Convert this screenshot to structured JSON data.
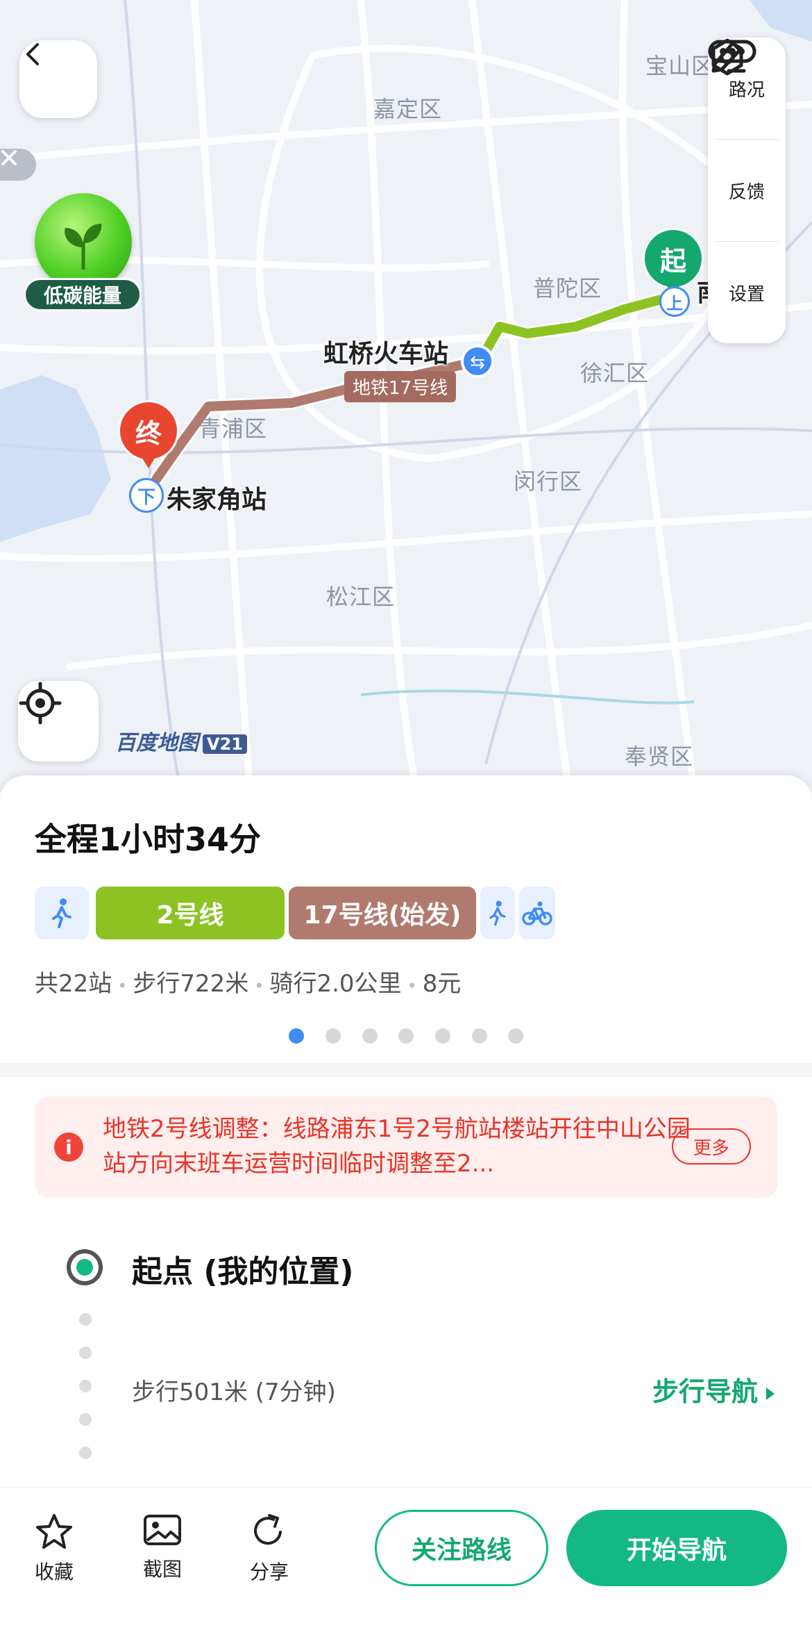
{
  "map": {
    "districts": [
      "宝山区",
      "嘉定区",
      "普陀区",
      "徐汇区",
      "青浦区",
      "闵行区",
      "松江区",
      "奉贤区"
    ],
    "stations": {
      "hongqiao": "虹桥火车站",
      "zhujiajiao": "朱家角站",
      "start_partial": "南"
    },
    "line_tag": "地铁17号线",
    "start_marker": "起",
    "end_marker": "终",
    "board_marker": "上",
    "alight_marker": "下",
    "eco_label": "低碳能量",
    "brand": "百度地图",
    "brand_version": "V21",
    "side_panel": {
      "traffic": "路况",
      "feedback": "反馈",
      "settings": "设置"
    }
  },
  "route": {
    "total_time": "全程1小时34分",
    "segments": [
      {
        "type": "walk",
        "icon": "walk-icon"
      },
      {
        "type": "line",
        "label": "2号线",
        "color": "#8cc322"
      },
      {
        "type": "line",
        "label": "17号线(始发)",
        "color": "#b17a6f"
      },
      {
        "type": "walk",
        "icon": "walk-icon"
      },
      {
        "type": "bike",
        "icon": "bike-icon"
      }
    ],
    "summary": {
      "stations": "共22站",
      "walk": "步行722米",
      "bike": "骑行2.0公里",
      "fare": "8元"
    },
    "page_count": 7,
    "page_active": 0
  },
  "notice": {
    "text": "地铁2号线调整：线路浦东1号2号航站楼站开往中山公园站方向末班车运营时间临时调整至2...",
    "more": "更多"
  },
  "steps": {
    "start": "起点 (我的位置)",
    "walk": "步行501米 (7分钟)",
    "walk_nav": "步行导航"
  },
  "bottom": {
    "favorite": "收藏",
    "screenshot": "截图",
    "share": "分享",
    "follow": "关注路线",
    "start_nav": "开始导航"
  },
  "colors": {
    "accent": "#14b885",
    "line2": "#8cc322",
    "line17": "#b17a6f",
    "alert": "#e73428"
  }
}
